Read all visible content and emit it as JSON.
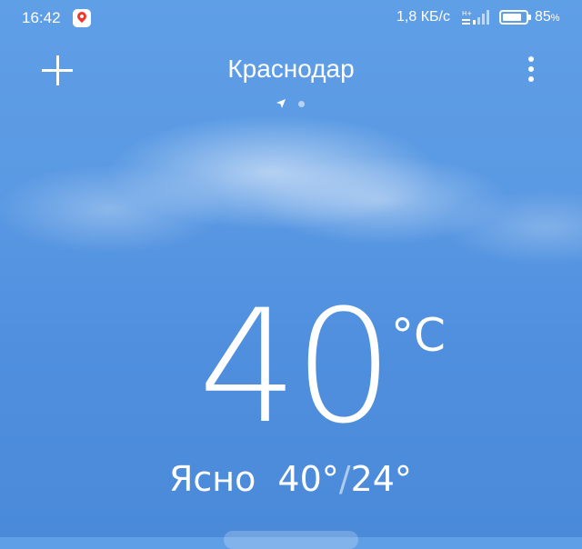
{
  "status_bar": {
    "time": "16:42",
    "notification_icon": "maps-pin-icon",
    "network_speed": "1,8 КБ/с",
    "signal_icon": "cell-signal-icon",
    "battery_icon": "battery-icon",
    "battery_level": 0.85,
    "battery_number": "85",
    "battery_unit": "%"
  },
  "header": {
    "add_icon": "plus-icon",
    "city": "Краснодар",
    "menu_icon": "more-vertical-icon",
    "pages": [
      "current-location",
      "saved-city"
    ],
    "active_page": 0
  },
  "weather": {
    "temperature": "40",
    "unit": "°C",
    "condition": "Ясно",
    "high": "40°",
    "separator": "/",
    "low": "24°"
  },
  "colors": {
    "sky_top": "#5f9fe6",
    "sky_bottom": "#4a8ad9",
    "text": "#ffffff",
    "maps_pin": "#f0362b"
  }
}
